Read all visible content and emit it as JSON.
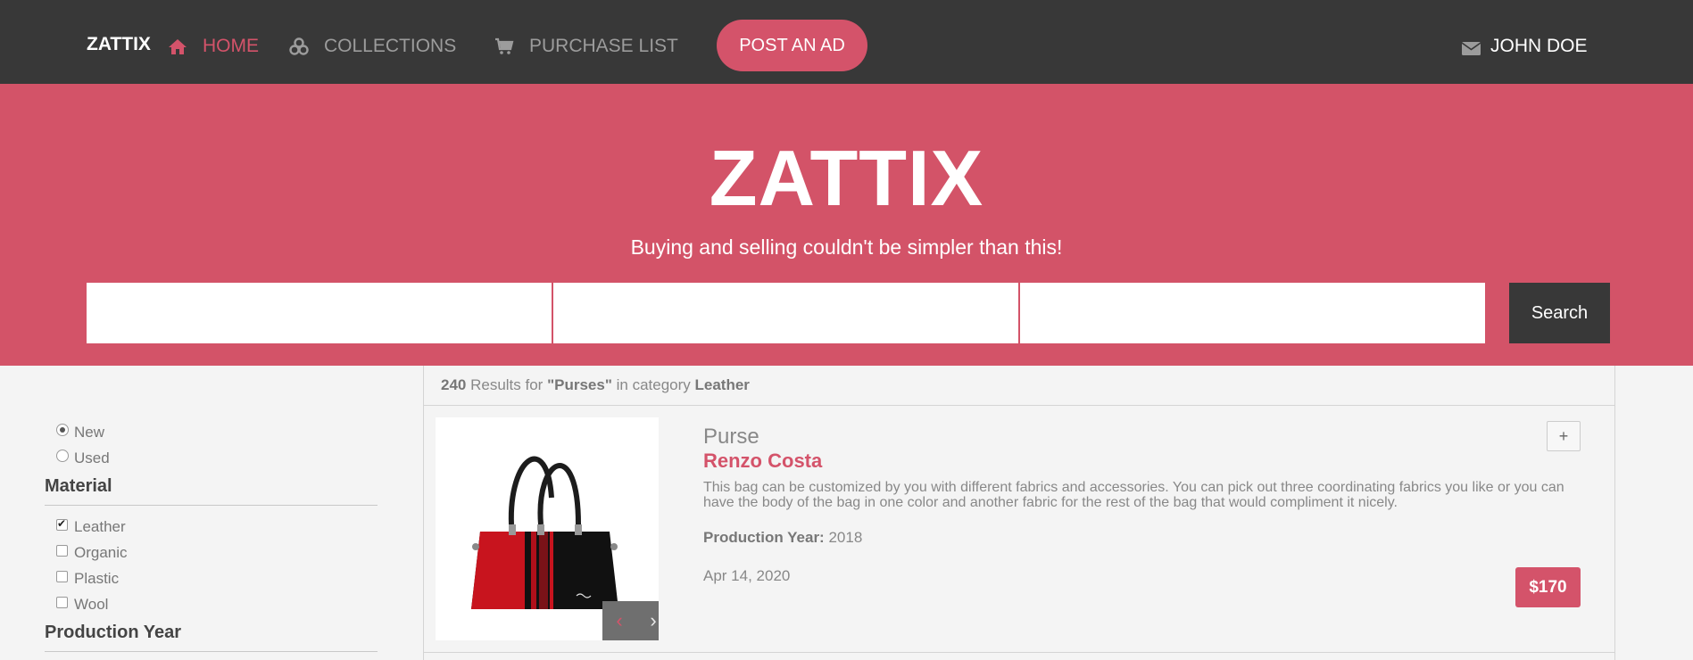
{
  "nav": {
    "brand": "ZATTIX",
    "home_label": "HOME",
    "collections_label": "COLLECTIONS",
    "purchase_label": "PURCHASE LIST",
    "post_ad_label": "POST AN AD",
    "user_name": "JOHN DOE",
    "home_icon": "home-icon",
    "collections_icon": "cubes-icon",
    "purchase_icon": "cart-icon",
    "user_icon": "envelope-icon"
  },
  "hero": {
    "title": "ZATTIX",
    "subtitle": "Buying and selling couldn't be simpler than this!",
    "search_fields": [
      "",
      "",
      ""
    ],
    "search_label": "Search"
  },
  "filters": {
    "condition": [
      {
        "label": "New",
        "checked": true
      },
      {
        "label": "Used",
        "checked": false
      }
    ],
    "material_heading": "Material",
    "materials": [
      {
        "label": "Leather",
        "checked": true
      },
      {
        "label": "Organic",
        "checked": false
      },
      {
        "label": "Plastic",
        "checked": false
      },
      {
        "label": "Wool",
        "checked": false
      }
    ],
    "production_year_heading": "Production Year"
  },
  "results": {
    "count": "240",
    "text_results_for": " Results for ",
    "query": "\"Purses\"",
    "text_in_category": " in category ",
    "category": "Leather"
  },
  "product": {
    "name": "Purse",
    "brand": "Renzo Costa",
    "description": "This bag can be customized by you with different fabrics and accessories. You can pick out three coordinating fabrics you like or you can have the body of the bag in one color and another fabric for the rest of the bag that would compliment it nicely.",
    "production_year_label": "Production Year:",
    "production_year": "2018",
    "date": "Apr 14, 2020",
    "price": "$170",
    "add_label": "+",
    "prev_label": "‹",
    "next_label": "›"
  },
  "colors": {
    "accent": "#d4536a",
    "dark": "#383838",
    "background": "#f4f4f4"
  }
}
